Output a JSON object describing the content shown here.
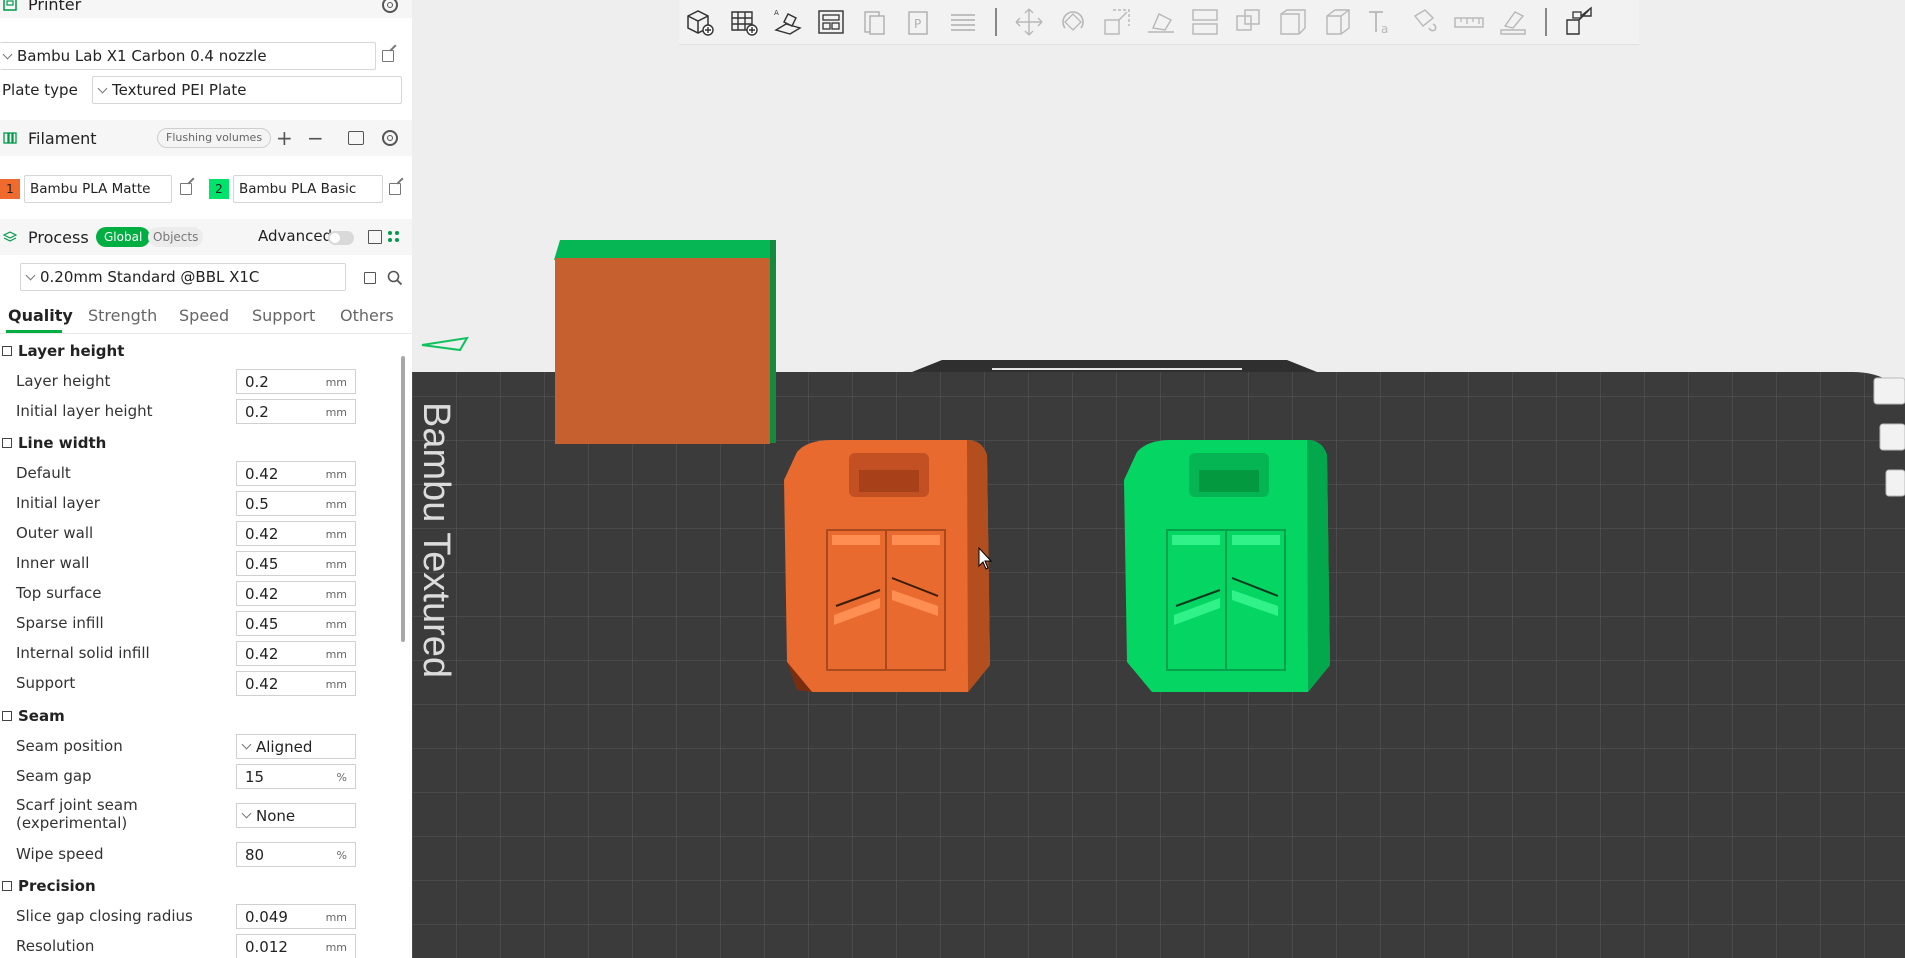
{
  "printer": {
    "title": "Printer",
    "preset": "Bambu Lab X1 Carbon 0.4 nozzle",
    "plate_type_label": "Plate type",
    "plate_type": "Textured PEI Plate"
  },
  "filament": {
    "title": "Filament",
    "flushing_label": "Flushing volumes",
    "add_glyph": "+",
    "remove_glyph": "−",
    "items": [
      {
        "index": "1",
        "name": "Bambu PLA Matte",
        "color": "#ef6a2c"
      },
      {
        "index": "2",
        "name": "Bambu PLA Basic",
        "color": "#00e36b"
      }
    ]
  },
  "process": {
    "title": "Process",
    "toggle_global": "Global",
    "toggle_objects": "Objects",
    "advanced_label": "Advanced",
    "preset": "0.20mm Standard @BBL X1C",
    "tabs": [
      "Quality",
      "Strength",
      "Speed",
      "Support",
      "Others"
    ],
    "groups": {
      "layer_height": {
        "title": "Layer height",
        "opts": [
          {
            "label": "Layer height",
            "value": "0.2",
            "unit": "mm"
          },
          {
            "label": "Initial layer height",
            "value": "0.2",
            "unit": "mm"
          }
        ]
      },
      "line_width": {
        "title": "Line width",
        "opts": [
          {
            "label": "Default",
            "value": "0.42",
            "unit": "mm"
          },
          {
            "label": "Initial layer",
            "value": "0.5",
            "unit": "mm"
          },
          {
            "label": "Outer wall",
            "value": "0.42",
            "unit": "mm"
          },
          {
            "label": "Inner wall",
            "value": "0.45",
            "unit": "mm"
          },
          {
            "label": "Top surface",
            "value": "0.42",
            "unit": "mm"
          },
          {
            "label": "Sparse infill",
            "value": "0.45",
            "unit": "mm"
          },
          {
            "label": "Internal solid infill",
            "value": "0.42",
            "unit": "mm"
          },
          {
            "label": "Support",
            "value": "0.42",
            "unit": "mm"
          }
        ]
      },
      "seam": {
        "title": "Seam",
        "position_label": "Seam position",
        "position_value": "Aligned",
        "gap_label": "Seam gap",
        "gap_value": "15",
        "gap_unit": "%",
        "scarf_label_1": "Scarf joint seam",
        "scarf_label_2": "(experimental)",
        "scarf_value": "None",
        "wipe_label": "Wipe speed",
        "wipe_value": "80",
        "wipe_unit": "%"
      },
      "precision": {
        "title": "Precision",
        "opts": [
          {
            "label": "Slice gap closing radius",
            "value": "0.049",
            "unit": "mm"
          },
          {
            "label": "Resolution",
            "value": "0.012",
            "unit": "mm"
          }
        ]
      }
    }
  },
  "viewport": {
    "plate_text": "Bambu Textured",
    "object_colors": {
      "orange": "#e86a2f",
      "green": "#05d663",
      "brown": "#c15f2f"
    }
  },
  "toolbar_icons": [
    "add-cube-icon",
    "add-plate-icon",
    "auto-orient-icon",
    "arrange-icon",
    "copy-icon",
    "paste-icon",
    "layers-icon",
    "move-icon",
    "rotate-icon",
    "scale-icon",
    "lay-on-face-icon",
    "cut-icon",
    "split-objects-icon",
    "split-parts-icon",
    "variable-height-icon",
    "text-icon",
    "paint-support-icon",
    "measure-icon",
    "assembly-icon",
    "explode-icon"
  ]
}
